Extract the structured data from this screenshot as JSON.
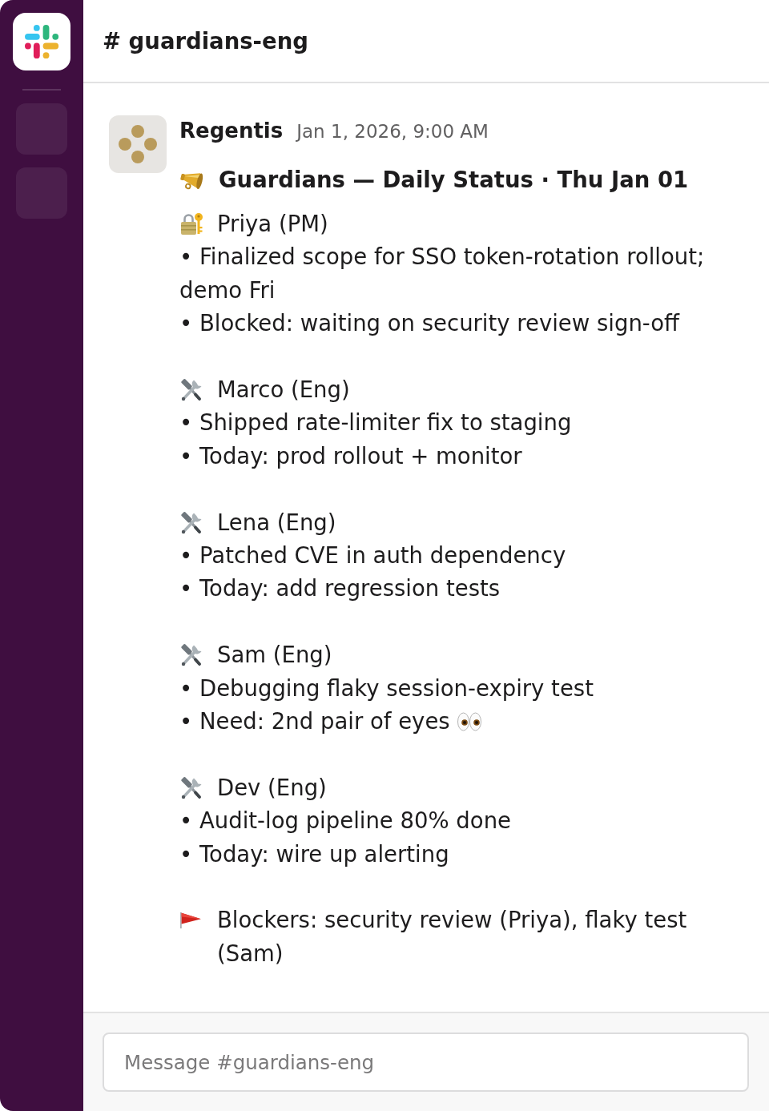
{
  "channel": {
    "title": "# guardians-eng"
  },
  "message": {
    "author": "Regentis",
    "time": "Jan 1, 2026, 9:00 AM",
    "headline": "Guardians — Daily Status · Thu Jan 01",
    "sections": [
      {
        "kind": "pm",
        "title": "Priya (PM)",
        "bullets": [
          {
            "kind": "note",
            "text": "• Finalized scope for SSO token-rotation rollout; demo Fri"
          },
          {
            "kind": "note",
            "text": "• Blocked: waiting on security review sign-off"
          }
        ]
      },
      {
        "kind": "eng",
        "title": "Marco (Eng)",
        "bullets": [
          {
            "kind": "note",
            "text": "• Shipped rate-limiter fix to staging"
          },
          {
            "kind": "note",
            "text": "• Today: prod rollout + monitor"
          }
        ]
      },
      {
        "kind": "eng",
        "title": "Lena (Eng)",
        "bullets": [
          {
            "kind": "note",
            "text": "• Patched CVE in auth dependency"
          },
          {
            "kind": "note",
            "text": "• Today: add regression tests"
          }
        ]
      },
      {
        "kind": "eng",
        "title": "Sam (Eng)",
        "bullets": [
          {
            "kind": "note",
            "text": "• Debugging flaky session-expiry test"
          },
          {
            "kind": "ask",
            "text": "• Need: 2nd pair of eyes"
          }
        ]
      },
      {
        "kind": "eng",
        "title": "Dev (Eng)",
        "bullets": [
          {
            "kind": "note",
            "text": "• Audit-log pipeline 80% done"
          },
          {
            "kind": "note",
            "text": "• Today: wire up alerting"
          }
        ]
      },
      {
        "kind": "blockers",
        "title": "Blockers: security review (Priya), flaky test (Sam)"
      }
    ]
  },
  "composer": {
    "placeholder": "Message #guardians-eng"
  }
}
